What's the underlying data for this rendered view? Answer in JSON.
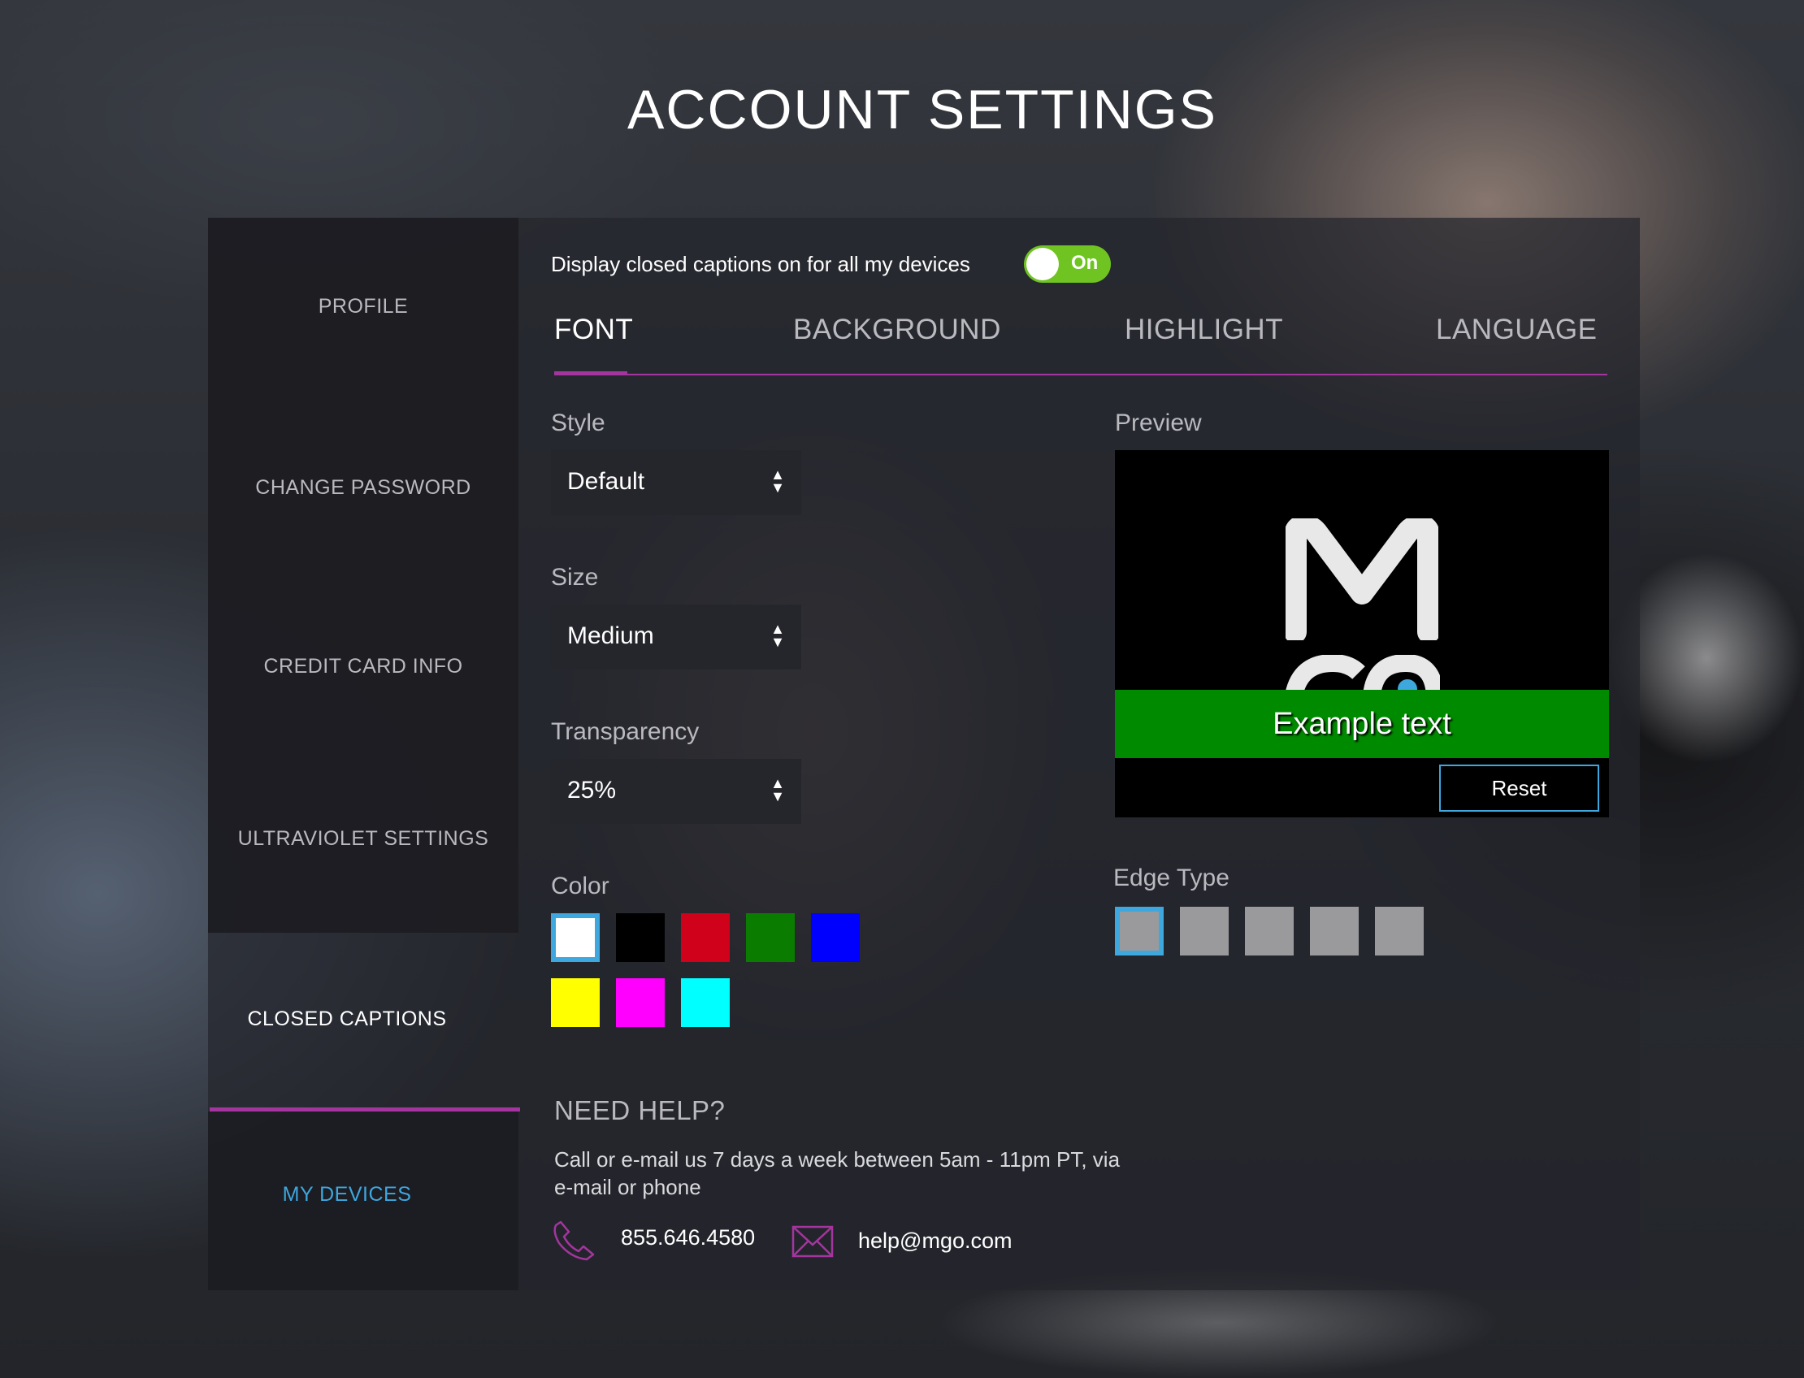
{
  "page": {
    "title": "ACCOUNT SETTINGS"
  },
  "sidebar": {
    "items": [
      {
        "label": "PROFILE",
        "state": "default"
      },
      {
        "label": "CHANGE PASSWORD",
        "state": "default"
      },
      {
        "label": "CREDIT CARD INFO",
        "state": "default"
      },
      {
        "label": "ULTRAVIOLET SETTINGS",
        "state": "default"
      },
      {
        "label": "CLOSED CAPTIONS",
        "state": "active"
      },
      {
        "label": "MY DEVICES",
        "state": "link"
      }
    ]
  },
  "captions_toggle": {
    "label": "Display closed captions on for all my devices",
    "state": "On"
  },
  "tabs": [
    {
      "label": "FONT",
      "active": true
    },
    {
      "label": "BACKGROUND",
      "active": false
    },
    {
      "label": "HIGHLIGHT",
      "active": false
    },
    {
      "label": "LANGUAGE",
      "active": false
    }
  ],
  "font_settings": {
    "style": {
      "label": "Style",
      "value": "Default"
    },
    "size": {
      "label": "Size",
      "value": "Medium"
    },
    "transparency": {
      "label": "Transparency",
      "value": "25%"
    },
    "color": {
      "label": "Color",
      "swatches": [
        "#ffffff",
        "#000000",
        "#d0021b",
        "#0a7d00",
        "#0000ff",
        "#ffff00",
        "#ff00ff",
        "#00ffff"
      ],
      "selected": "#ffffff"
    }
  },
  "preview": {
    "label": "Preview",
    "example_text": "Example text",
    "reset_label": "Reset",
    "caption_bg_color": "#008a00"
  },
  "edge_type": {
    "label": "Edge Type",
    "options_count": 5,
    "selected_index": 0
  },
  "help": {
    "title": "NEED HELP?",
    "text": "Call or e-mail us 7 days a week between 5am - 11pm PT, via e-mail or phone",
    "phone": "855.646.4580",
    "email": "help@mgo.com",
    "icons": [
      "phone-icon",
      "mail-icon"
    ]
  },
  "colors": {
    "accent_purple": "#a4359e",
    "accent_blue": "#3da7de",
    "toggle_green": "#6fc421"
  }
}
